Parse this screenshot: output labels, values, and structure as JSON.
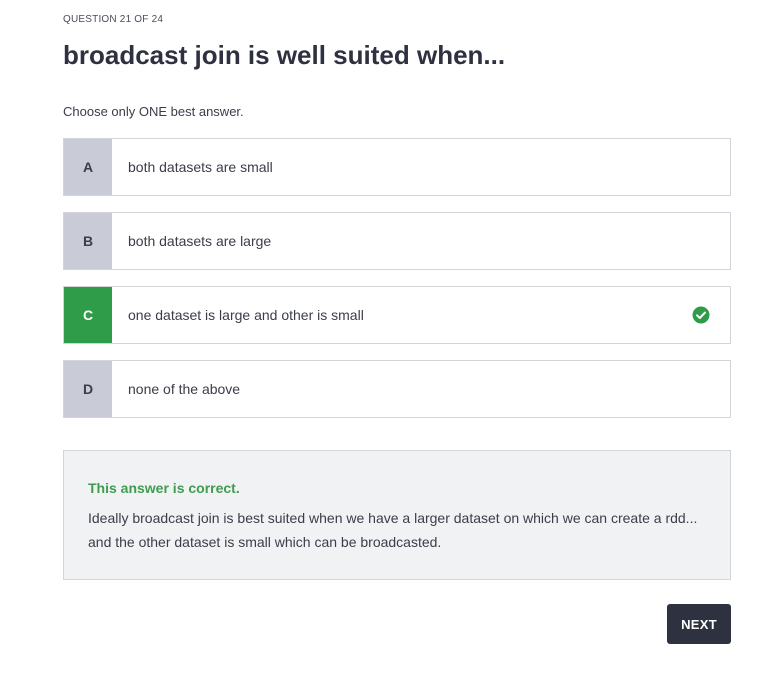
{
  "quiz": {
    "progress": "QUESTION 21 OF 24",
    "question": "broadcast join is well suited when...",
    "instruction": "Choose only ONE best answer.",
    "options": [
      {
        "letter": "A",
        "text": "both datasets are small",
        "state": "default"
      },
      {
        "letter": "B",
        "text": "both datasets are large",
        "state": "default"
      },
      {
        "letter": "C",
        "text": "one dataset is large and other is small",
        "state": "correct",
        "icon": "check-circle-icon"
      },
      {
        "letter": "D",
        "text": "none of the above",
        "state": "default"
      }
    ],
    "feedback": {
      "title": "This answer is correct.",
      "body": "Ideally broadcast join is best suited when we have a larger dataset on which we can create a rdd... and the other dataset is small which can be broadcasted."
    },
    "next_label": "NEXT"
  },
  "colors": {
    "correct": "#2f9c4a",
    "letter_default": "#c9ccd6",
    "button": "#2e3140",
    "feedback_bg": "#f1f2f4"
  }
}
